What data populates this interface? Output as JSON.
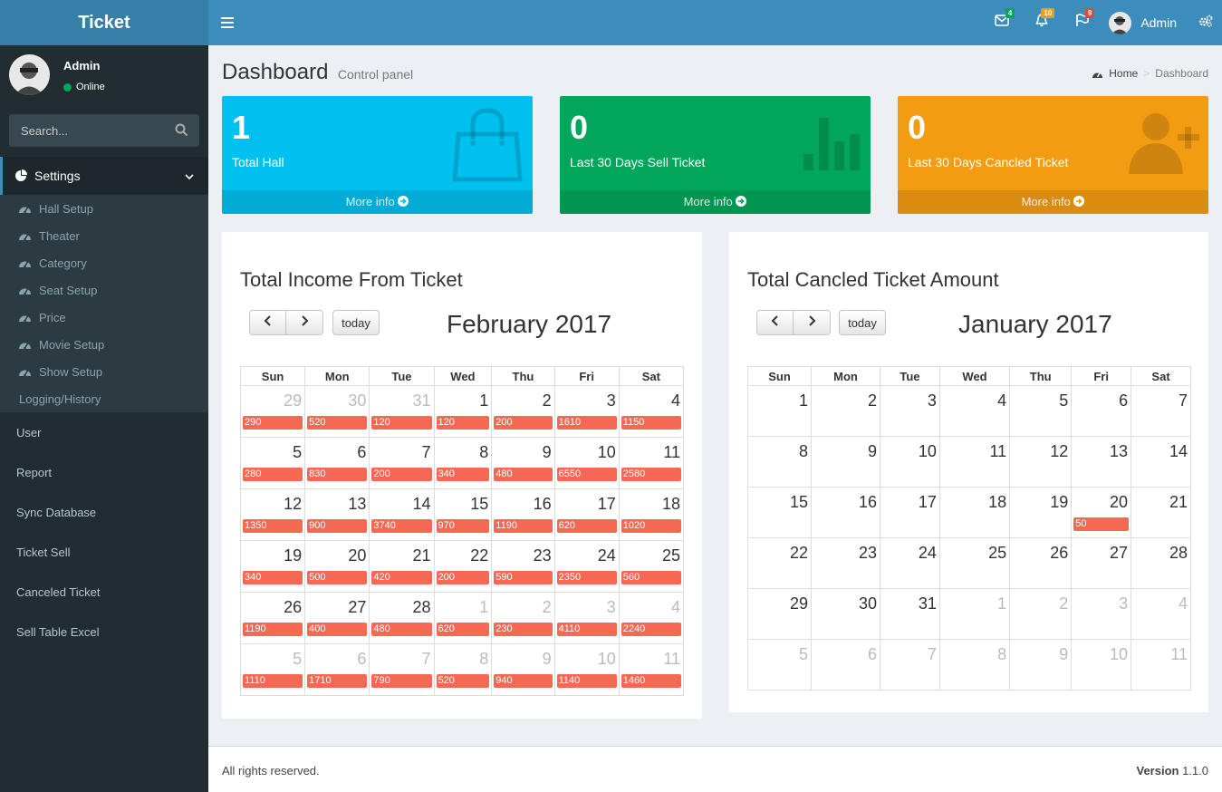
{
  "app": {
    "logo": "Ticket"
  },
  "user": {
    "name": "Admin",
    "status": "Online"
  },
  "search": {
    "placeholder": "Search..."
  },
  "sidebar": {
    "settings_label": "Settings",
    "submenu": [
      "Hall Setup",
      "Theater",
      "Category",
      "Seat Setup",
      "Price",
      "Movie Setup",
      "Show Setup"
    ],
    "logging_label": "Logging/History",
    "items": [
      "User",
      "Report",
      "Sync Database",
      "Ticket Sell",
      "Canceled Ticket",
      "Sell Table Excel"
    ]
  },
  "header": {
    "mail_count": "4",
    "notif_count": "10",
    "flag_count": "9",
    "user_name": "Admin"
  },
  "page": {
    "title": "Dashboard",
    "subtitle": "Control panel",
    "breadcrumb_home": "Home",
    "breadcrumb_active": "Dashboard"
  },
  "stats": [
    {
      "value": "1",
      "label": "Total Hall",
      "footer": "More info",
      "color": "#00c0ef"
    },
    {
      "value": "0",
      "label": "Last 30 Days Sell Ticket",
      "footer": "More info",
      "color": "#00a65a"
    },
    {
      "value": "0",
      "label": "Last 30 Days Cancled Ticket",
      "footer": "More info",
      "color": "#f39c12"
    }
  ],
  "calendars": [
    {
      "title": "Total Income From Ticket",
      "month": "February 2017",
      "today_label": "today",
      "weekdays": [
        "Sun",
        "Mon",
        "Tue",
        "Wed",
        "Thu",
        "Fri",
        "Sat"
      ],
      "weeks": [
        [
          {
            "d": "29",
            "o": true,
            "e": "290"
          },
          {
            "d": "30",
            "o": true,
            "e": "520"
          },
          {
            "d": "31",
            "o": true,
            "e": "120"
          },
          {
            "d": "1",
            "e": "120"
          },
          {
            "d": "2",
            "e": "200"
          },
          {
            "d": "3",
            "e": "1610"
          },
          {
            "d": "4",
            "e": "1150"
          }
        ],
        [
          {
            "d": "5",
            "e": "280"
          },
          {
            "d": "6",
            "e": "830"
          },
          {
            "d": "7",
            "e": "200"
          },
          {
            "d": "8",
            "e": "340"
          },
          {
            "d": "9",
            "e": "480"
          },
          {
            "d": "10",
            "e": "6550"
          },
          {
            "d": "11",
            "e": "2580"
          }
        ],
        [
          {
            "d": "12",
            "e": "1350"
          },
          {
            "d": "13",
            "e": "900"
          },
          {
            "d": "14",
            "e": "3740"
          },
          {
            "d": "15",
            "e": "970"
          },
          {
            "d": "16",
            "e": "1190"
          },
          {
            "d": "17",
            "e": "620"
          },
          {
            "d": "18",
            "e": "1020"
          }
        ],
        [
          {
            "d": "19",
            "e": "340"
          },
          {
            "d": "20",
            "e": "500"
          },
          {
            "d": "21",
            "e": "420"
          },
          {
            "d": "22",
            "e": "200"
          },
          {
            "d": "23",
            "e": "590"
          },
          {
            "d": "24",
            "e": "2350"
          },
          {
            "d": "25",
            "e": "560"
          }
        ],
        [
          {
            "d": "26",
            "e": "1190"
          },
          {
            "d": "27",
            "e": "400"
          },
          {
            "d": "28",
            "e": "480"
          },
          {
            "d": "1",
            "o": true,
            "e": "620"
          },
          {
            "d": "2",
            "o": true,
            "e": "230"
          },
          {
            "d": "3",
            "o": true,
            "e": "4110"
          },
          {
            "d": "4",
            "o": true,
            "e": "2240"
          }
        ],
        [
          {
            "d": "5",
            "o": true,
            "e": "1110"
          },
          {
            "d": "6",
            "o": true,
            "e": "1710"
          },
          {
            "d": "7",
            "o": true,
            "e": "790"
          },
          {
            "d": "8",
            "o": true,
            "e": "520"
          },
          {
            "d": "9",
            "o": true,
            "e": "940"
          },
          {
            "d": "10",
            "o": true,
            "e": "1140"
          },
          {
            "d": "11",
            "o": true,
            "e": "1460"
          }
        ]
      ]
    },
    {
      "title": "Total Cancled Ticket Amount",
      "month": "January 2017",
      "today_label": "today",
      "weekdays": [
        "Sun",
        "Mon",
        "Tue",
        "Wed",
        "Thu",
        "Fri",
        "Sat"
      ],
      "weeks": [
        [
          {
            "d": "1"
          },
          {
            "d": "2"
          },
          {
            "d": "3"
          },
          {
            "d": "4"
          },
          {
            "d": "5"
          },
          {
            "d": "6"
          },
          {
            "d": "7"
          }
        ],
        [
          {
            "d": "8"
          },
          {
            "d": "9"
          },
          {
            "d": "10"
          },
          {
            "d": "11"
          },
          {
            "d": "12"
          },
          {
            "d": "13"
          },
          {
            "d": "14"
          }
        ],
        [
          {
            "d": "15"
          },
          {
            "d": "16"
          },
          {
            "d": "17"
          },
          {
            "d": "18"
          },
          {
            "d": "19"
          },
          {
            "d": "20",
            "e": "50"
          },
          {
            "d": "21"
          }
        ],
        [
          {
            "d": "22"
          },
          {
            "d": "23"
          },
          {
            "d": "24"
          },
          {
            "d": "25"
          },
          {
            "d": "26"
          },
          {
            "d": "27"
          },
          {
            "d": "28"
          }
        ],
        [
          {
            "d": "29"
          },
          {
            "d": "30"
          },
          {
            "d": "31"
          },
          {
            "d": "1",
            "o": true
          },
          {
            "d": "2",
            "o": true
          },
          {
            "d": "3",
            "o": true
          },
          {
            "d": "4",
            "o": true
          }
        ],
        [
          {
            "d": "5",
            "o": true
          },
          {
            "d": "6",
            "o": true
          },
          {
            "d": "7",
            "o": true
          },
          {
            "d": "8",
            "o": true
          },
          {
            "d": "9",
            "o": true
          },
          {
            "d": "10",
            "o": true
          },
          {
            "d": "11",
            "o": true
          }
        ]
      ]
    }
  ],
  "footer": {
    "copyright": "All rights reserved.",
    "version_label": "Version",
    "version": "1.1.0"
  }
}
